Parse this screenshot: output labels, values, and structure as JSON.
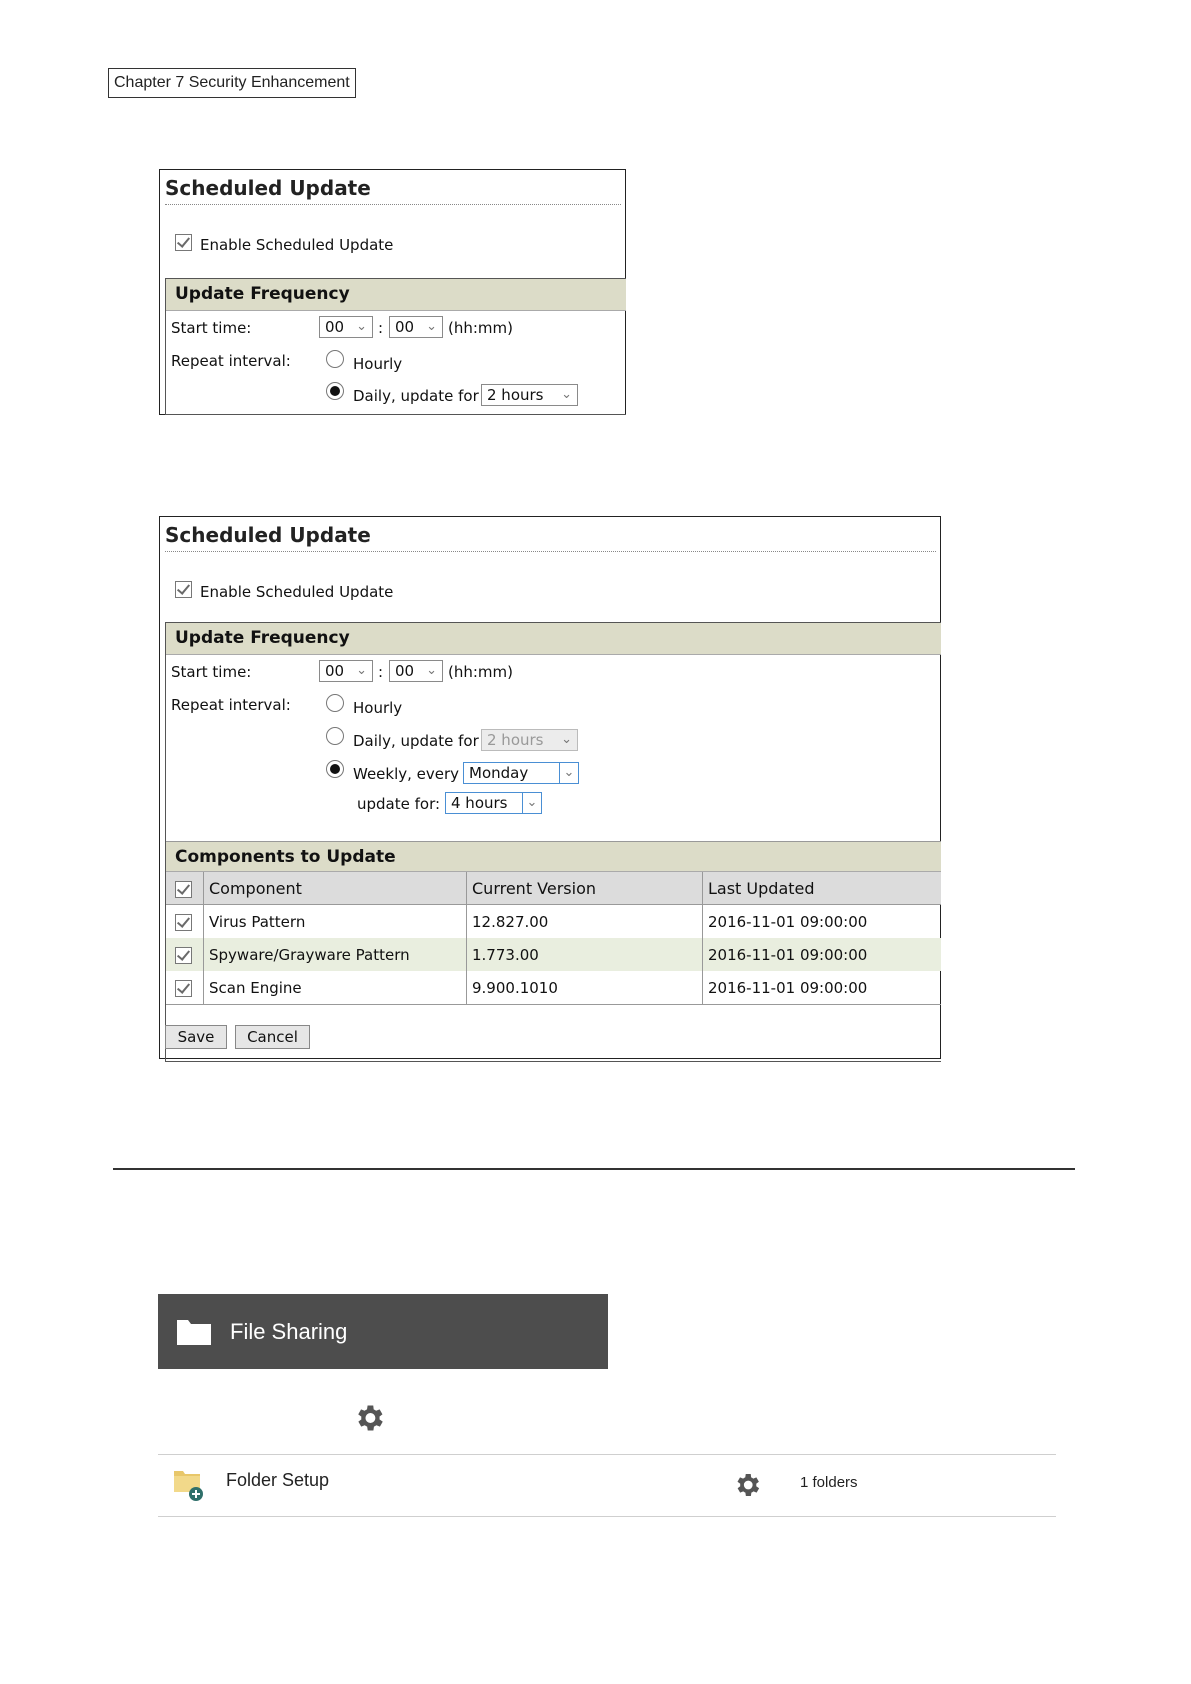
{
  "chapter_label": "Chapter 7 Security Enhancement",
  "panel_daily": {
    "title": "Scheduled Update",
    "enable_label": "Enable Scheduled Update",
    "frequency_header": "Update Frequency",
    "start_time_label": "Start time:",
    "hour_value": "00",
    "colon": ":",
    "minute_value": "00",
    "time_format": "(hh:mm)",
    "repeat_label": "Repeat interval:",
    "hourly_label": "Hourly",
    "daily_label": "Daily, update for",
    "daily_duration": "2 hours"
  },
  "panel_weekly": {
    "title": "Scheduled Update",
    "enable_label": "Enable Scheduled Update",
    "frequency_header": "Update Frequency",
    "start_time_label": "Start time:",
    "hour_value": "00",
    "colon": ":",
    "minute_value": "00",
    "time_format": "(hh:mm)",
    "repeat_label": "Repeat interval:",
    "hourly_label": "Hourly",
    "daily_label": "Daily, update for",
    "daily_duration": "2 hours",
    "weekly_label": "Weekly, every",
    "weekly_day": "Monday",
    "update_for_label": "update for:",
    "weekly_duration": "4 hours",
    "components_header": "Components to Update",
    "columns": [
      "Component",
      "Current Version",
      "Last Updated"
    ],
    "rows": [
      {
        "component": "Virus Pattern",
        "version": "12.827.00",
        "updated": "2016-11-01 09:00:00"
      },
      {
        "component": "Spyware/Grayware Pattern",
        "version": "1.773.00",
        "updated": "2016-11-01 09:00:00"
      },
      {
        "component": "Scan Engine",
        "version": "9.900.1010",
        "updated": "2016-11-01 09:00:00"
      }
    ],
    "save_label": "Save",
    "cancel_label": "Cancel"
  },
  "file_sharing": {
    "title": "File Sharing",
    "folder_setup_label": "Folder Setup",
    "folders_count": "1 folders"
  },
  "icons": {
    "folder": "folder-icon",
    "gear": "gear-icon",
    "folder_add": "folder-add-icon"
  },
  "colors": {
    "section_header_bg": "#dcdcc8",
    "alt_row_bg": "#e9eedf",
    "file_sharing_bar": "#4d4d4d",
    "select_focus_border": "#4a8fd4"
  }
}
